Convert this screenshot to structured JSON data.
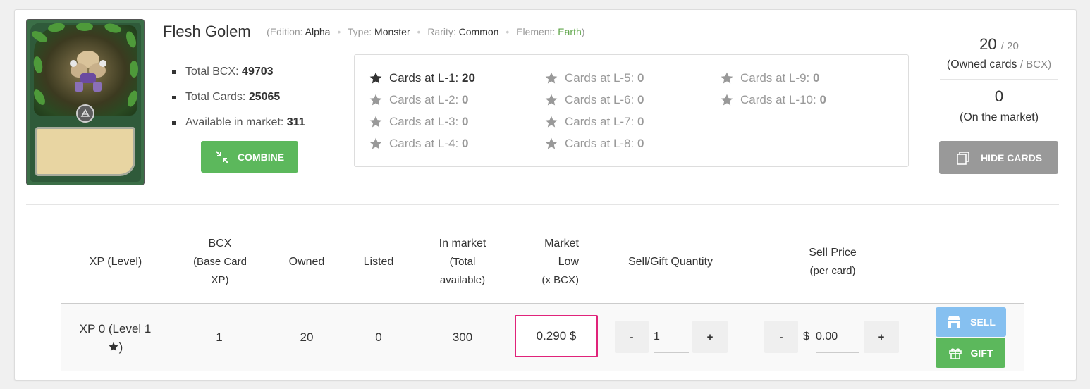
{
  "card": {
    "name": "Flesh Golem",
    "edition_label": "(Edition:",
    "edition": "Alpha",
    "type_label": "Type:",
    "type": "Monster",
    "rarity_label": "Rarity:",
    "rarity": "Common",
    "element_label": "Element:",
    "element": "Earth",
    "close_paren": ")",
    "separator": "•",
    "element_color": "#5fa64a"
  },
  "stats": {
    "total_bcx_label": "Total BCX:",
    "total_bcx": "49703",
    "total_cards_label": "Total Cards:",
    "total_cards": "25065",
    "available_label": "Available in market:",
    "available": "311"
  },
  "buttons": {
    "combine": "COMBINE",
    "hide_cards": "HIDE CARDS",
    "sell": "SELL",
    "gift": "GIFT",
    "minus": "-",
    "plus": "+"
  },
  "levels": [
    {
      "label": "Cards at L-1:",
      "value": "20",
      "active": true
    },
    {
      "label": "Cards at L-2:",
      "value": "0",
      "active": false
    },
    {
      "label": "Cards at L-3:",
      "value": "0",
      "active": false
    },
    {
      "label": "Cards at L-4:",
      "value": "0",
      "active": false
    },
    {
      "label": "Cards at L-5:",
      "value": "0",
      "active": false
    },
    {
      "label": "Cards at L-6:",
      "value": "0",
      "active": false
    },
    {
      "label": "Cards at L-7:",
      "value": "0",
      "active": false
    },
    {
      "label": "Cards at L-8:",
      "value": "0",
      "active": false
    },
    {
      "label": "Cards at L-9:",
      "value": "0",
      "active": false
    },
    {
      "label": "Cards at L-10:",
      "value": "0",
      "active": false
    }
  ],
  "ownership": {
    "owned": "20",
    "slash_bcx": "/ 20",
    "owned_label_open": "(Owned cards",
    "owned_label_bcx": "/ BCX)",
    "on_market": "0",
    "on_market_label": "(On the market)"
  },
  "table": {
    "headers": {
      "xp_level": "XP (Level)",
      "bcx_line1": "BCX",
      "bcx_line2": "(Base Card",
      "bcx_line3": "XP)",
      "owned": "Owned",
      "listed": "Listed",
      "in_market_line1": "In market",
      "in_market_line2": "(Total",
      "in_market_line3": "available)",
      "market_low_line1": "Market",
      "market_low_line2": "Low",
      "market_low_line3": "(x BCX)",
      "sell_gift_qty": "Sell/Gift Quantity",
      "sell_price_line1": "Sell Price",
      "sell_price_line2": "(per card)"
    },
    "row": {
      "xp_level_line1": "XP 0 (Level 1",
      "xp_level_line2": ")",
      "bcx": "1",
      "owned": "20",
      "listed": "0",
      "in_market": "300",
      "market_low": "0.290 $",
      "quantity": "1",
      "currency": "$",
      "price": "0.00"
    }
  },
  "colors": {
    "combine": "#5cb85c",
    "hide": "#999999",
    "sell": "#86c0f0",
    "gift": "#5cb85c",
    "highlight": "#e0237a"
  }
}
